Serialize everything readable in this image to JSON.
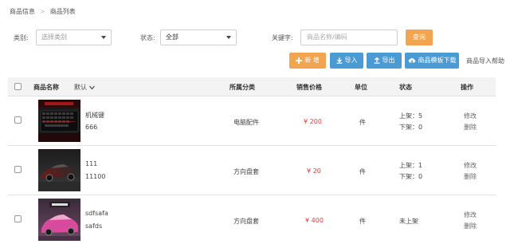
{
  "breadcrumb": [
    "商品信息",
    "商品列表"
  ],
  "filters": {
    "category_label": "类别:",
    "category_placeholder": "选择类别",
    "status_label": "状态:",
    "status_value": "全部",
    "keyword_label": "关键字:",
    "keyword_placeholder": "商品名称/编码",
    "query_button": "查询"
  },
  "actions": {
    "add": "新 增",
    "import": "导入",
    "export": "导出",
    "template": "商品模板下载",
    "help": "商品导入帮助"
  },
  "table": {
    "headers": {
      "name": "商品名称",
      "sort": "默认",
      "category": "所属分类",
      "price": "销售价格",
      "unit": "单位",
      "status": "状态",
      "ops": "操作"
    },
    "rows": [
      {
        "name": "机械键",
        "code": "666",
        "category": "电脑配件",
        "price": "¥ 200",
        "unit": "件",
        "status_up": "上架：5",
        "status_down": "下架：0",
        "op_edit": "修改",
        "op_delete": "删除",
        "thumb": "keyboard"
      },
      {
        "name": "111",
        "code": "11100",
        "category": "方向盘套",
        "price": "¥ 20",
        "unit": "件",
        "status_up": "上架：1",
        "status_down": "下架：0",
        "op_edit": "修改",
        "op_delete": "删除",
        "thumb": "car-dark"
      },
      {
        "name": "sdfsafa",
        "code": "safds",
        "category": "方向盘套",
        "price": "¥ 400",
        "unit": "件",
        "status_up": "未上架",
        "status_down": "",
        "op_edit": "修改",
        "op_delete": "删除",
        "thumb": "car-pink"
      }
    ]
  },
  "colors": {
    "orange": "#f3a450",
    "blue": "#4a9ad4",
    "price_red": "#e4393c"
  },
  "icons": [
    "plus-icon",
    "import-icon",
    "export-icon",
    "cloud-download-icon",
    "chevron-down-icon"
  ]
}
